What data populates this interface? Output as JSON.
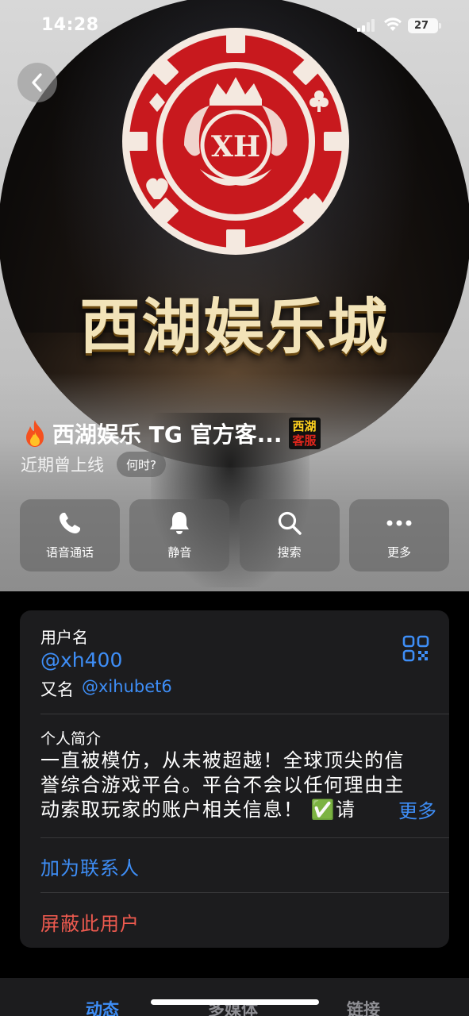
{
  "status_bar": {
    "time": "14:28",
    "battery_level": "27"
  },
  "hero": {
    "brand_text": "西湖娱乐城",
    "logo_monogram": "XH",
    "profile_name": "西湖娱乐 TG 官方客...",
    "badge_line_1": "西湖",
    "badge_line_2": "客服",
    "presence": "近期曾上线",
    "when_label": "何时?"
  },
  "actions": [
    {
      "label": "语音通话",
      "icon": "phone-icon"
    },
    {
      "label": "静音",
      "icon": "bell-icon"
    },
    {
      "label": "搜索",
      "icon": "search-icon"
    },
    {
      "label": "更多",
      "icon": "more-icon"
    }
  ],
  "info": {
    "username_label": "用户名",
    "username": "@xh400",
    "alias_label": "又名",
    "alias": "@xihubet6",
    "bio_label": "个人简介",
    "bio": "一直被模仿，从未被超越！全球顶尖的信誉综合游戏平台。平台不会以任何理由主动索取玩家的账户相关信息！ ✅请",
    "bio_more": "更多",
    "add_contact": "加为联系人",
    "block_user": "屏蔽此用户"
  },
  "tabs": [
    {
      "label": "动态",
      "active": true
    },
    {
      "label": "多媒体",
      "active": false
    },
    {
      "label": "链接",
      "active": false
    }
  ],
  "colors": {
    "accent": "#3e8ef7",
    "destructive": "#ee5a4f",
    "card": "#1c1c1e",
    "chip_red": "#c8191e"
  }
}
